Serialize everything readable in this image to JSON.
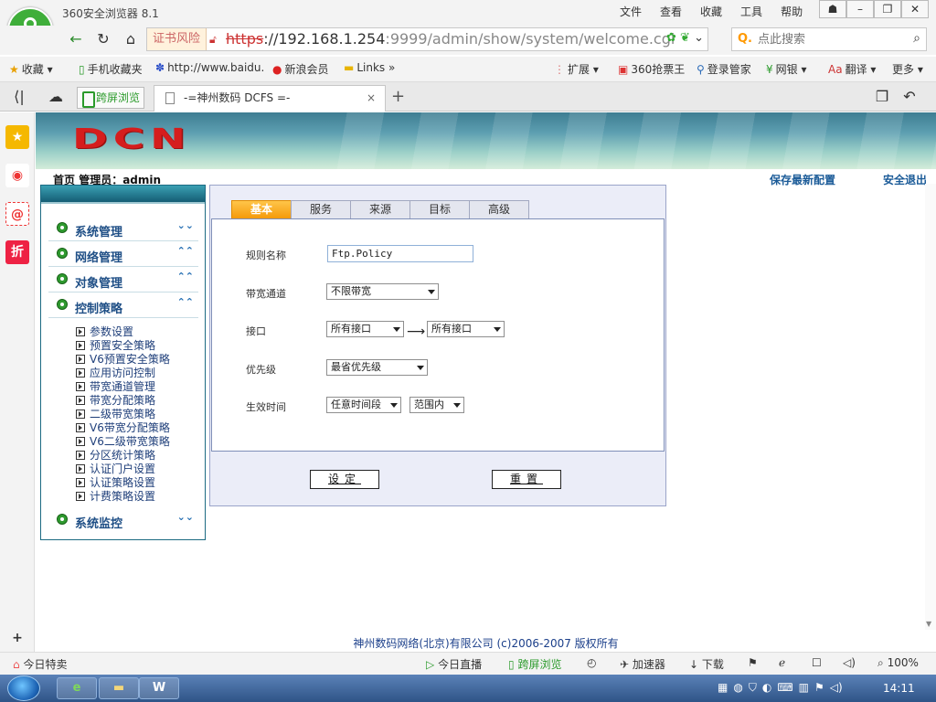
{
  "browser": {
    "title": "360安全浏览器 8.1",
    "menus": [
      "文件",
      "查看",
      "收藏",
      "工具",
      "帮助"
    ],
    "cert_warning": "证书风险",
    "url_scheme": "https",
    "url_host": "://192.168.1.254",
    "url_rest": ":9999/admin/show/system/welcome.cgi",
    "search_placeholder": "点此搜索",
    "bookmarks": [
      "收藏",
      "手机收藏夹",
      "http://www.baidu.",
      "新浪会员",
      "Links",
      "扩展",
      "360抢票王",
      "登录管家",
      "网银",
      "翻译",
      "更多"
    ],
    "split_tab": "跨屏浏览",
    "active_tab": "-=神州数码 DCFS =-"
  },
  "page": {
    "logo": "DCN",
    "home": "首页",
    "admin_label": "管理员：admin",
    "save_config": "保存最新配置",
    "logout": "安全退出",
    "footer": "神州数码网络(北京)有限公司 (c)2006-2007 版权所有"
  },
  "sidebar": {
    "sections": [
      {
        "label": "系统管理",
        "chev": "⌄⌄"
      },
      {
        "label": "网络管理",
        "chev": "⌃⌃"
      },
      {
        "label": "对象管理",
        "chev": "⌃⌃"
      },
      {
        "label": "控制策略",
        "chev": "⌃⌃"
      }
    ],
    "items": [
      "参数设置",
      "预置安全策略",
      "V6预置安全策略",
      "应用访问控制",
      "带宽通道管理",
      "带宽分配策略",
      "二级带宽策略",
      "V6带宽分配策略",
      "V6二级带宽策略",
      "分区统计策略",
      "认证门户设置",
      "认证策略设置",
      "计费策略设置"
    ],
    "monitor": {
      "label": "系统监控",
      "chev": "⌄⌄"
    }
  },
  "panel": {
    "tabs": [
      "基本",
      "服务",
      "来源",
      "目标",
      "高级"
    ],
    "fields": {
      "rule_name_label": "规则名称",
      "rule_name_value": "Ftp.Policy",
      "bandwidth_label": "带宽通道",
      "bandwidth_value": "不限带宽",
      "interface_label": "接口",
      "interface_from": "所有接口",
      "interface_to": "所有接口",
      "interface_arrow": "⟶",
      "priority_label": "优先级",
      "priority_value": "最省优先级",
      "time_label": "生效时间",
      "time_value": "任意时间段",
      "time_range": "范围内"
    },
    "buttons": {
      "submit": "设定",
      "reset": "重置"
    }
  },
  "statusbar": {
    "left": "今日特卖",
    "items": [
      "今日直播",
      "跨屏浏览",
      "加速器",
      "下载",
      "100%"
    ]
  },
  "taskbar": {
    "clock": "14:11"
  }
}
